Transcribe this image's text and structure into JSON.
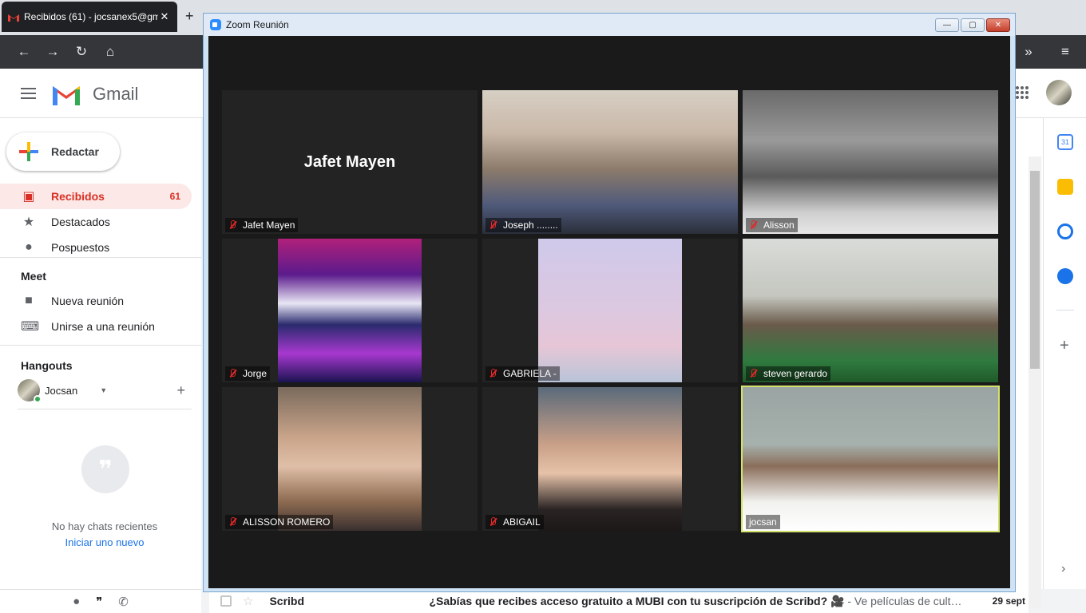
{
  "browser": {
    "tab_title": "Recibidos (61) - jocsanex5@gm",
    "tab_close": "✕",
    "new_tab": "+"
  },
  "gmail": {
    "logo_text": "Gmail",
    "compose_label": "Redactar",
    "nav": [
      {
        "label": "Recibidos",
        "count": "61",
        "icon": "inbox-icon"
      },
      {
        "label": "Destacados",
        "icon": "star-icon"
      },
      {
        "label": "Pospuestos",
        "icon": "clock-icon"
      }
    ],
    "meet": {
      "title": "Meet",
      "items": [
        {
          "label": "Nueva reunión",
          "icon": "video-icon"
        },
        {
          "label": "Unirse a una reunión",
          "icon": "keyboard-icon"
        }
      ]
    },
    "hangouts": {
      "title": "Hangouts",
      "user": "Jocsan",
      "no_chats": "No hay chats recientes",
      "start_new": "Iniciar uno nuevo"
    },
    "email_row": {
      "sender": "Scribd",
      "subject": "¿Sabías que recibes acceso gratuito a MUBI con tu suscripción de Scribd? 🎥",
      "snippet": " - Ve películas de cult…",
      "date": "29 sept"
    },
    "accent": "#d93025"
  },
  "zoom": {
    "window_title": "Zoom Reunión",
    "participants": [
      {
        "name": "Jafet Mayen",
        "video": false,
        "muted": true
      },
      {
        "name": "Joseph ........",
        "video": true,
        "muted": true
      },
      {
        "name": "Alisson",
        "video": true,
        "muted": true
      },
      {
        "name": "Jorge",
        "video": true,
        "muted": true
      },
      {
        "name": "GABRIELA -",
        "video": true,
        "muted": true
      },
      {
        "name": "steven gerardo",
        "video": true,
        "muted": true
      },
      {
        "name": "ALISSON ROMERO",
        "video": true,
        "muted": true
      },
      {
        "name": "ABIGAIL",
        "video": true,
        "muted": true
      },
      {
        "name": "jocsan",
        "video": true,
        "muted": false,
        "active_speaker": true
      }
    ]
  }
}
